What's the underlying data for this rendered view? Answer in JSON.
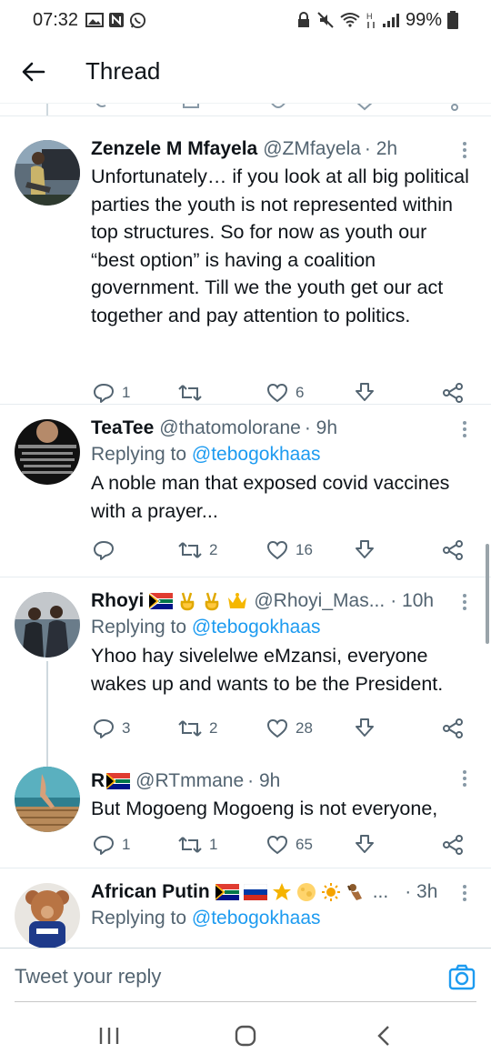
{
  "status_bar": {
    "time": "07:32",
    "battery": "99%"
  },
  "header": {
    "title": "Thread"
  },
  "tweets": [
    {
      "name": "Zenzele M Mfayela",
      "handle": "@ZMfayela",
      "time": "· 2h",
      "text": "Unfortunately… if you look at all big political parties the youth is not represented within top structures. So for now as youth our “best option” is having a coalition government. Till we the youth get our act together and pay attention to politics.",
      "replies": "1",
      "retweets": "",
      "likes": "6"
    },
    {
      "name": "TeaTee",
      "handle": "@thatomolorane",
      "time": "· 9h",
      "reply_prefix": "Replying to",
      "reply_mention": "@tebogokhaas",
      "text": "A noble man that exposed covid vaccines with a prayer...",
      "replies": "",
      "retweets": "2",
      "likes": "16"
    },
    {
      "name": "Rhoyi",
      "handle": "@Rhoyi_Mas...",
      "time": "· 10h",
      "reply_prefix": "Replying to",
      "reply_mention": "@tebogokhaas",
      "text": "Yhoo hay sivelelwe eMzansi, everyone wakes up and wants to be the President.",
      "replies": "3",
      "retweets": "2",
      "likes": "28"
    },
    {
      "name": "R",
      "handle": "@RTmmane",
      "time": "· 9h",
      "text": "But Mogoeng Mogoeng is not everyone,",
      "replies": "1",
      "retweets": "1",
      "likes": "65"
    },
    {
      "name": "African Putin",
      "handle": "...",
      "time": "· 3h",
      "reply_prefix": "Replying to",
      "reply_mention": "@tebogokhaas"
    }
  ],
  "composer": {
    "placeholder": "Tweet your reply"
  },
  "colors": {
    "accent": "#1d9bf0",
    "secondary_text": "#536471",
    "divider": "#e6ecf0"
  }
}
